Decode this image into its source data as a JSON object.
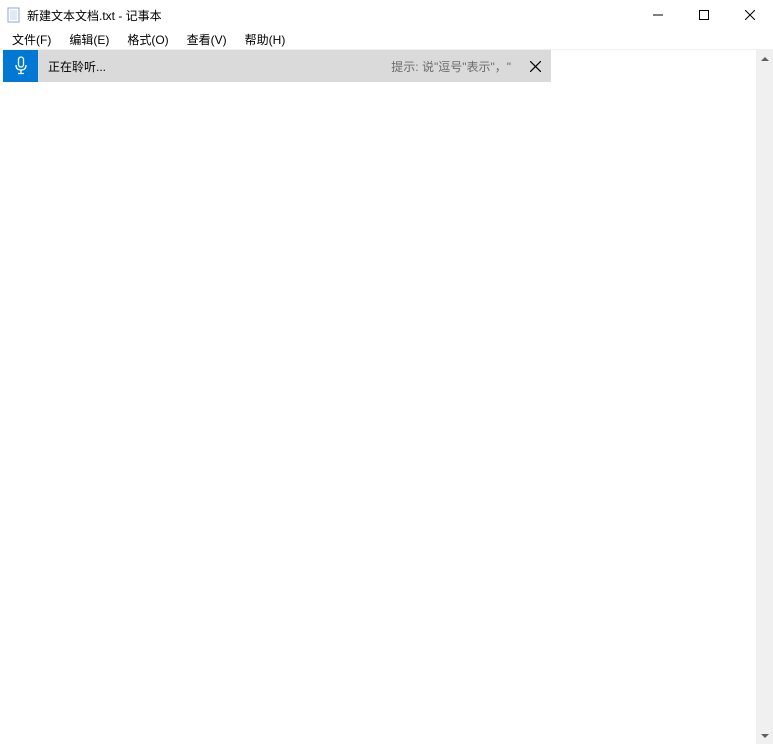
{
  "titlebar": {
    "title": "新建文本文档.txt - 记事本"
  },
  "menubar": {
    "items": [
      {
        "label": "文件(F)"
      },
      {
        "label": "编辑(E)"
      },
      {
        "label": "格式(O)"
      },
      {
        "label": "查看(V)"
      },
      {
        "label": "帮助(H)"
      }
    ]
  },
  "dictation": {
    "status": "正在聆听...",
    "hint": "提示: 说\"逗号\"表示\"，\""
  },
  "editor": {
    "content": ""
  }
}
